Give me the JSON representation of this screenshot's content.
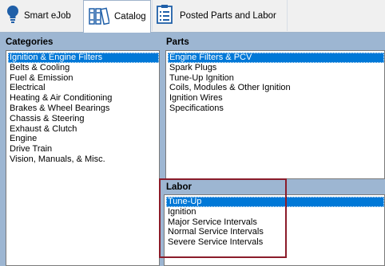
{
  "tabs": {
    "smart_ejob": "Smart eJob",
    "catalog": "Catalog",
    "posted": "Posted Parts and Labor"
  },
  "categories": {
    "title": "Categories",
    "items": [
      "Ignition & Engine Filters",
      "Belts & Cooling",
      "Fuel & Emission",
      "Electrical",
      "Heating & Air Conditioning",
      "Brakes & Wheel Bearings",
      "Chassis & Steering",
      "Exhaust & Clutch",
      "Engine",
      "Drive Train",
      "Vision, Manuals, & Misc."
    ],
    "selected_index": 0
  },
  "parts": {
    "title": "Parts",
    "items": [
      "Engine Filters & PCV",
      "Spark Plugs",
      "Tune-Up Ignition",
      "Coils, Modules & Other Ignition",
      "Ignition Wires",
      "Specifications"
    ],
    "selected_index": 0
  },
  "labor": {
    "title": "Labor",
    "items": [
      "Tune-Up",
      "Ignition",
      "Major Service Intervals",
      "Normal Service Intervals",
      "Severe Service Intervals"
    ],
    "selected_index": 0
  },
  "colors": {
    "selection": "#0078d7",
    "panel_bg": "#9db6d2",
    "annotation_border": "#8b1c2a"
  },
  "icons": {
    "smart_ejob": "lightbulb-icon",
    "catalog": "binders-icon",
    "posted": "clipboard-list-icon"
  }
}
